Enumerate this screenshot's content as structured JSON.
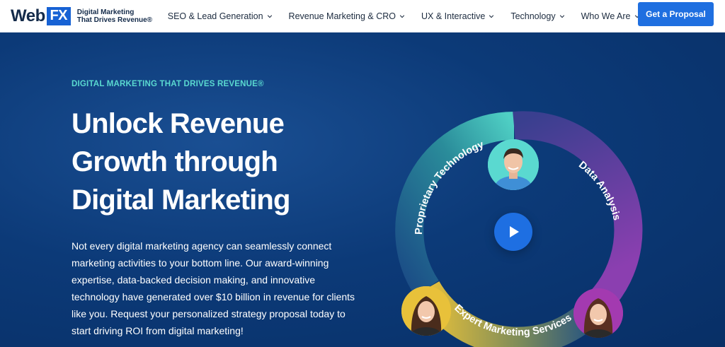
{
  "header": {
    "logo_web": "Web",
    "logo_fx": "FX",
    "tagline_line1": "Digital Marketing",
    "tagline_line2": "That Drives Revenue®",
    "nav": [
      {
        "label": "SEO & Lead Generation"
      },
      {
        "label": "Revenue Marketing & CRO"
      },
      {
        "label": "UX & Interactive"
      },
      {
        "label": "Technology"
      },
      {
        "label": "Who We Are"
      }
    ],
    "cta_label": "Get a Proposal"
  },
  "hero": {
    "eyebrow": "DIGITAL MARKETING THAT DRIVES REVENUE®",
    "headline_line1": "Unlock Revenue",
    "headline_line2": "Growth through",
    "headline_line3": "Digital Marketing",
    "body": "Not every digital marketing agency can seamlessly connect marketing activities to your bottom line. Our award-winning expertise, data-backed decision making, and innovative technology have generated over $10 billion in revenue for clients like you. Request your personalized strategy proposal today to start driving ROI from digital marketing!"
  },
  "graphic": {
    "arc_labels": {
      "proprietary": "Proprietary Technology",
      "data": "Data Analysis",
      "expert": "Expert Marketing Services"
    },
    "colors": {
      "teal": "#5ad9d0",
      "purple": "#8b3fb0",
      "yellow": "#e8c13a",
      "play": "#1e6fe2"
    },
    "icons": [
      "play-icon"
    ]
  }
}
